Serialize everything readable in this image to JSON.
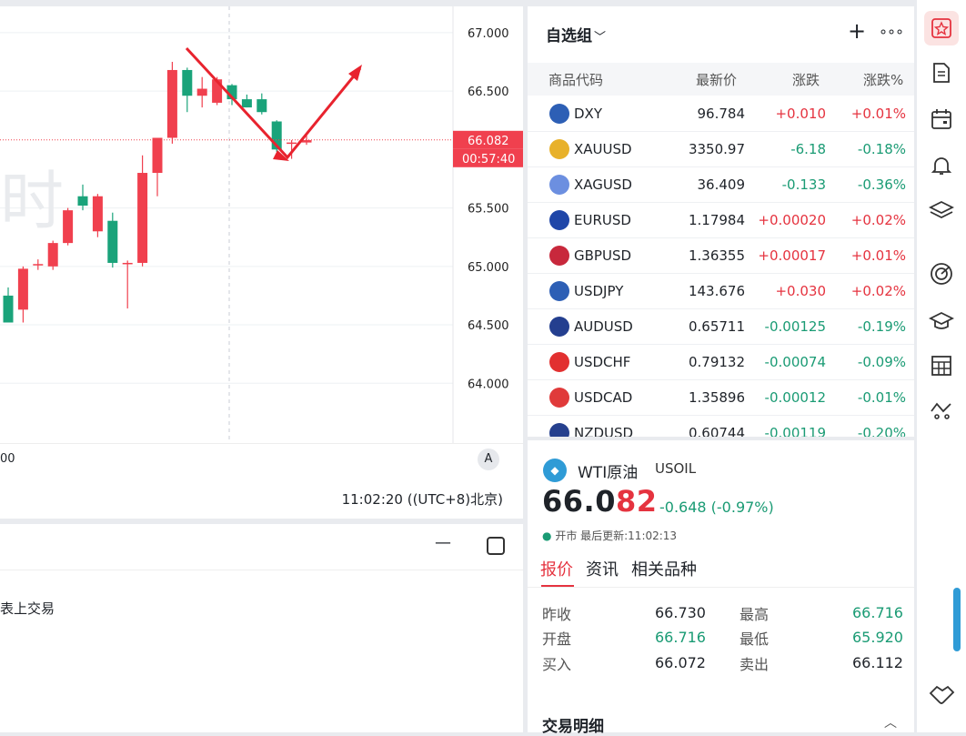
{
  "chart": {
    "y_ticks": [
      "67.000",
      "66.500",
      "65.500",
      "65.000",
      "64.500",
      "64.000"
    ],
    "watermark": "时",
    "current_price_tag": "66.082",
    "countdown_tag": "00:57:40",
    "x_label": "00",
    "auto_scale_label": "A",
    "clock": "11:02:20 ((UTC+8)北京)",
    "colors": {
      "up": "#f0404e",
      "down": "#1aa37a",
      "arrow": "#e8232e"
    }
  },
  "chart_data": {
    "type": "candlestick",
    "ylim": [
      63.8,
      67.1
    ],
    "candles": [
      {
        "o": 64.75,
        "h": 64.82,
        "l": 64.55,
        "c": 64.52
      },
      {
        "o": 64.63,
        "h": 65.0,
        "l": 64.52,
        "c": 64.98
      },
      {
        "o": 65.02,
        "h": 65.06,
        "l": 64.97,
        "c": 65.02
      },
      {
        "o": 65.0,
        "h": 65.22,
        "l": 64.97,
        "c": 65.2
      },
      {
        "o": 65.2,
        "h": 65.5,
        "l": 65.18,
        "c": 65.48
      },
      {
        "o": 65.6,
        "h": 65.7,
        "l": 65.48,
        "c": 65.52
      },
      {
        "o": 65.3,
        "h": 65.62,
        "l": 65.25,
        "c": 65.6
      },
      {
        "o": 65.39,
        "h": 65.46,
        "l": 64.99,
        "c": 65.03
      },
      {
        "o": 65.02,
        "h": 65.05,
        "l": 64.64,
        "c": 65.03
      },
      {
        "o": 65.03,
        "h": 65.95,
        "l": 65.0,
        "c": 65.8
      },
      {
        "o": 65.8,
        "h": 66.1,
        "l": 65.6,
        "c": 66.1
      },
      {
        "o": 66.1,
        "h": 66.75,
        "l": 66.05,
        "c": 66.68
      },
      {
        "o": 66.68,
        "h": 66.7,
        "l": 66.32,
        "c": 66.46
      },
      {
        "o": 66.46,
        "h": 66.62,
        "l": 66.36,
        "c": 66.52
      },
      {
        "o": 66.4,
        "h": 66.62,
        "l": 66.38,
        "c": 66.6
      },
      {
        "o": 66.55,
        "h": 66.56,
        "l": 66.38,
        "c": 66.43
      },
      {
        "o": 66.43,
        "h": 66.47,
        "l": 66.36,
        "c": 66.36
      },
      {
        "o": 66.43,
        "h": 66.48,
        "l": 66.3,
        "c": 66.32
      },
      {
        "o": 66.24,
        "h": 66.25,
        "l": 65.98,
        "c": 66.0
      },
      {
        "o": 66.05,
        "h": 66.08,
        "l": 65.92,
        "c": 66.06
      },
      {
        "o": 66.06,
        "h": 66.12,
        "l": 66.04,
        "c": 66.08
      }
    ],
    "current": 66.082
  },
  "watchlist": {
    "title": "自选组",
    "headers": [
      "商品代码",
      "最新价",
      "涨跌",
      "涨跌%"
    ],
    "rows": [
      {
        "sym": "DXY",
        "price": "96.784",
        "chg": "+0.010",
        "pct": "+0.01%",
        "dir": "up",
        "flag": "us"
      },
      {
        "sym": "XAUUSD",
        "price": "3350.97",
        "chg": "-6.18",
        "pct": "-0.18%",
        "dir": "down",
        "flag": "gold"
      },
      {
        "sym": "XAGUSD",
        "price": "36.409",
        "chg": "-0.133",
        "pct": "-0.36%",
        "dir": "down",
        "flag": "silver"
      },
      {
        "sym": "EURUSD",
        "price": "1.17984",
        "chg": "+0.00020",
        "pct": "+0.02%",
        "dir": "up",
        "flag": "eu"
      },
      {
        "sym": "GBPUSD",
        "price": "1.36355",
        "chg": "+0.00017",
        "pct": "+0.01%",
        "dir": "up",
        "flag": "gb"
      },
      {
        "sym": "USDJPY",
        "price": "143.676",
        "chg": "+0.030",
        "pct": "+0.02%",
        "dir": "up",
        "flag": "us"
      },
      {
        "sym": "AUDUSD",
        "price": "0.65711",
        "chg": "-0.00125",
        "pct": "-0.19%",
        "dir": "down",
        "flag": "au"
      },
      {
        "sym": "USDCHF",
        "price": "0.79132",
        "chg": "-0.00074",
        "pct": "-0.09%",
        "dir": "down",
        "flag": "ch"
      },
      {
        "sym": "USDCAD",
        "price": "1.35896",
        "chg": "-0.00012",
        "pct": "-0.01%",
        "dir": "down",
        "flag": "ca"
      },
      {
        "sym": "NZDUSD",
        "price": "0.60744",
        "chg": "-0.00119",
        "pct": "-0.20%",
        "dir": "down",
        "flag": "nz"
      }
    ]
  },
  "detail": {
    "name": "WTI原油",
    "code": "USOIL",
    "price_main": "66.0",
    "price_tail": "82",
    "change": "-0.648 (-0.97%)",
    "status": "开市 最后更新:11:02:13",
    "tabs": [
      "报价",
      "资讯",
      "相关品种"
    ],
    "quotes": {
      "prev_close_label": "昨收",
      "prev_close": "66.730",
      "high_label": "最高",
      "high": "66.716",
      "open_label": "开盘",
      "open": "66.716",
      "low_label": "最低",
      "low": "65.920",
      "bid_label": "买入",
      "bid": "66.072",
      "ask_label": "卖出",
      "ask": "66.112"
    },
    "section_title": "交易明细"
  },
  "bottom": {
    "message": "表上交易"
  }
}
